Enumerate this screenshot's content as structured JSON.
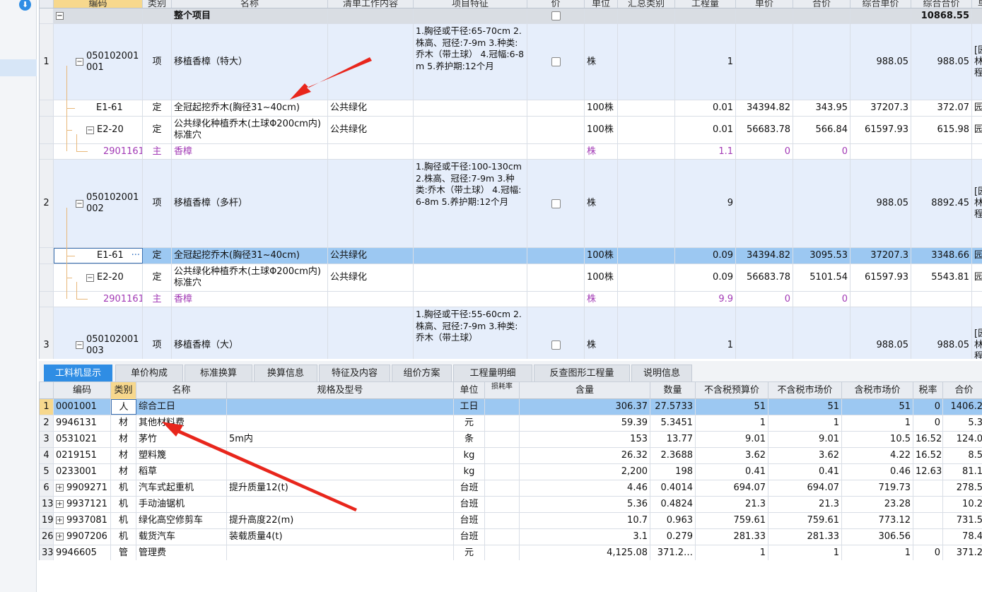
{
  "left_panel": {
    "download_icon": "download-icon"
  },
  "top_grid": {
    "headers": [
      "编码",
      "类别",
      "名称",
      "清单工作内容",
      "项目特征",
      "价",
      "单位",
      "汇总类别",
      "工程量",
      "单价",
      "合价",
      "综合单价",
      "综合合价",
      "单"
    ],
    "total_row": {
      "name": "整个项目",
      "total": "10868.55"
    },
    "rows": [
      {
        "idx": "1",
        "code": "050102001001",
        "type": "项",
        "name": "移植香樟（特大）",
        "work": "",
        "feature": "1.胸径或干径:65-70cm 2.株高、冠径:7-9m 3.种类:乔木（带土球） 4.冠幅:6-8m 5.养护期:12个月",
        "unit": "株",
        "summary": "",
        "qty": "1",
        "price": "",
        "amount": "",
        "cprice": "988.05",
        "camount": "988.05",
        "extra": "[园林程"
      },
      {
        "idx": "",
        "code": "E1-61",
        "type": "定",
        "name": "全冠起挖乔木(胸径31~40cm)",
        "work": "公共绿化",
        "feature": "",
        "unit": "100株",
        "summary": "",
        "qty": "0.01",
        "price": "34394.82",
        "amount": "343.95",
        "cprice": "37207.3",
        "camount": "372.07",
        "extra": "园"
      },
      {
        "idx": "",
        "code": "E2-20",
        "type": "定",
        "name": "公共绿化种植乔木(土球Φ200cm内) 标准穴",
        "work": "公共绿化",
        "feature": "",
        "unit": "100株",
        "summary": "",
        "qty": "0.01",
        "price": "56683.78",
        "amount": "566.84",
        "cprice": "61597.93",
        "camount": "615.98",
        "extra": "园"
      },
      {
        "idx": "",
        "code": "2901161@1",
        "type": "主",
        "name": "香樟",
        "work": "",
        "feature": "",
        "unit": "株",
        "summary": "",
        "qty": "1.1",
        "price": "0",
        "amount": "0",
        "cprice": "",
        "camount": "",
        "extra": ""
      },
      {
        "idx": "2",
        "code": "050102001002",
        "type": "项",
        "name": "移植香樟（多杆）",
        "work": "",
        "feature": "1.胸径或干径:100-130cm 2.株高、冠径:7-9m 3.种类:乔木（带土球） 4.冠幅:6-8m 5.养护期:12个月",
        "unit": "株",
        "summary": "",
        "qty": "9",
        "price": "",
        "amount": "",
        "cprice": "988.05",
        "camount": "8892.45",
        "extra": "[园林程"
      },
      {
        "idx": "",
        "code": "E1-61",
        "type": "定",
        "name": "全冠起挖乔木(胸径31~40cm)",
        "work": "公共绿化",
        "feature": "",
        "unit": "100株",
        "summary": "",
        "qty": "0.09",
        "price": "34394.82",
        "amount": "3095.53",
        "cprice": "37207.3",
        "camount": "3348.66",
        "extra": "园"
      },
      {
        "idx": "",
        "code": "E2-20",
        "type": "定",
        "name": "公共绿化种植乔木(土球Φ200cm内) 标准穴",
        "work": "公共绿化",
        "feature": "",
        "unit": "100株",
        "summary": "",
        "qty": "0.09",
        "price": "56683.78",
        "amount": "5101.54",
        "cprice": "61597.93",
        "camount": "5543.81",
        "extra": "园"
      },
      {
        "idx": "",
        "code": "2901161@2",
        "type": "主",
        "name": "香樟",
        "work": "",
        "feature": "",
        "unit": "株",
        "summary": "",
        "qty": "9.9",
        "price": "0",
        "amount": "0",
        "cprice": "",
        "camount": "",
        "extra": ""
      },
      {
        "idx": "3",
        "code": "050102001003",
        "type": "项",
        "name": "移植香樟（大）",
        "work": "",
        "feature": "1.胸径或干径:55-60cm 2.株高、冠径:7-9m 3.种类:乔木（带土球）",
        "unit": "株",
        "summary": "",
        "qty": "1",
        "price": "",
        "amount": "",
        "cprice": "988.05",
        "camount": "988.05",
        "extra": "[园林程"
      }
    ]
  },
  "tabs": [
    "工料机显示",
    "单价构成",
    "标准换算",
    "换算信息",
    "特征及内容",
    "组价方案",
    "工程量明细",
    "反查图形工程量",
    "说明信息"
  ],
  "bottom_grid": {
    "headers": [
      "编码",
      "类别",
      "名称",
      "规格及型号",
      "单位",
      "损耗率",
      "含量",
      "数量",
      "不含税预算价",
      "不含税市场价",
      "含税市场价",
      "税率",
      "合价"
    ],
    "rows": [
      {
        "idx": "1",
        "code": "0001001",
        "cat": "人",
        "name": "综合工日",
        "spec": "",
        "unit": "工日",
        "loss": "",
        "content": "306.37",
        "qty": "27.5733",
        "budget": "51",
        "market": "51",
        "taxmarket": "51",
        "tax": "0",
        "total": "1406.2"
      },
      {
        "idx": "2",
        "code": "9946131",
        "cat": "材",
        "name": "其他材料费",
        "spec": "",
        "unit": "元",
        "loss": "",
        "content": "59.39",
        "qty": "5.3451",
        "budget": "1",
        "market": "1",
        "taxmarket": "1",
        "tax": "0",
        "total": "5.3"
      },
      {
        "idx": "3",
        "code": "0531021",
        "cat": "材",
        "name": "茅竹",
        "spec": "5m内",
        "unit": "条",
        "loss": "",
        "content": "153",
        "qty": "13.77",
        "budget": "9.01",
        "market": "9.01",
        "taxmarket": "10.5",
        "tax": "16.52",
        "total": "124.0"
      },
      {
        "idx": "4",
        "code": "0219151",
        "cat": "材",
        "name": "塑料篾",
        "spec": "",
        "unit": "kg",
        "loss": "",
        "content": "26.32",
        "qty": "2.3688",
        "budget": "3.62",
        "market": "3.62",
        "taxmarket": "4.22",
        "tax": "16.52",
        "total": "8.5"
      },
      {
        "idx": "5",
        "code": "0233001",
        "cat": "材",
        "name": "稻草",
        "spec": "",
        "unit": "kg",
        "loss": "",
        "content": "2,200",
        "qty": "198",
        "budget": "0.41",
        "market": "0.41",
        "taxmarket": "0.46",
        "tax": "12.63",
        "total": "81.1"
      },
      {
        "idx": "6",
        "code": "9909271",
        "cat": "机",
        "name": "汽车式起重机",
        "spec": "提升质量12(t)",
        "unit": "台班",
        "loss": "",
        "content": "4.46",
        "qty": "0.4014",
        "budget": "694.07",
        "market": "694.07",
        "taxmarket": "719.73",
        "tax": "",
        "total": "278.5"
      },
      {
        "idx": "13",
        "code": "9937121",
        "cat": "机",
        "name": "手动油锯机",
        "spec": "",
        "unit": "台班",
        "loss": "",
        "content": "5.36",
        "qty": "0.4824",
        "budget": "21.3",
        "market": "21.3",
        "taxmarket": "23.28",
        "tax": "",
        "total": "10.2"
      },
      {
        "idx": "19",
        "code": "9937081",
        "cat": "机",
        "name": "绿化高空修剪车",
        "spec": "提升高度22(m)",
        "unit": "台班",
        "loss": "",
        "content": "10.7",
        "qty": "0.963",
        "budget": "759.61",
        "market": "759.61",
        "taxmarket": "773.12",
        "tax": "",
        "total": "731.5"
      },
      {
        "idx": "26",
        "code": "9907206",
        "cat": "机",
        "name": "载货汽车",
        "spec": "装载质量4(t)",
        "unit": "台班",
        "loss": "",
        "content": "3.1",
        "qty": "0.279",
        "budget": "281.33",
        "market": "281.33",
        "taxmarket": "306.56",
        "tax": "",
        "total": "78.4"
      },
      {
        "idx": "33",
        "code": "9946605",
        "cat": "管",
        "name": "管理费",
        "spec": "",
        "unit": "元",
        "loss": "",
        "content": "4,125.08",
        "qty": "371.2…",
        "budget": "1",
        "market": "1",
        "taxmarket": "1",
        "tax": "0",
        "total": "371.2"
      }
    ]
  },
  "annotations": {
    "arrow_color": "#e8261c"
  }
}
